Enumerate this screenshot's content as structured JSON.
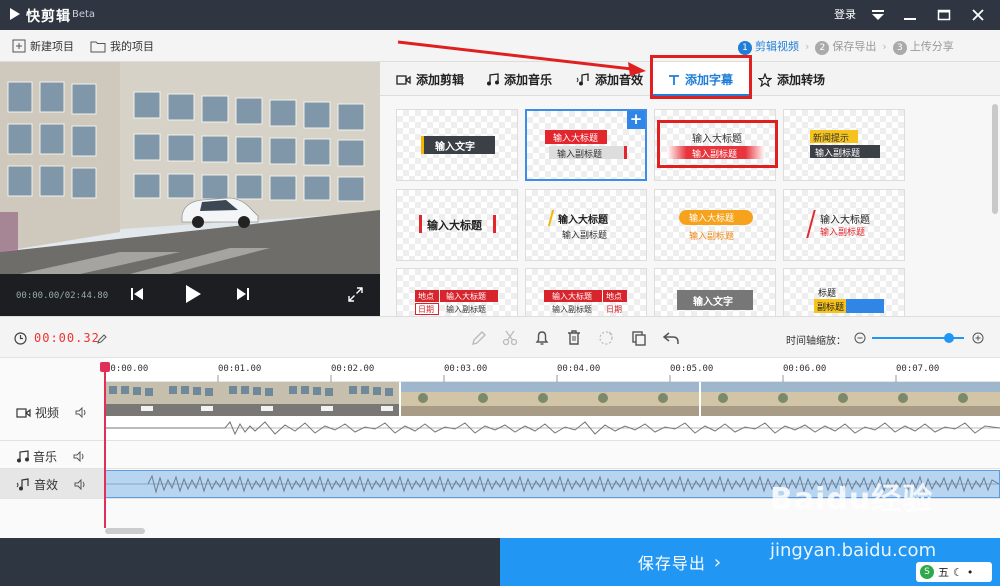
{
  "titlebar": {
    "app_name": "快剪辑",
    "beta": "Beta",
    "login": "登录"
  },
  "toolbar": {
    "new_project": "新建项目",
    "my_projects": "我的项目",
    "steps": [
      {
        "num": "1",
        "label": "剪辑视频"
      },
      {
        "num": "2",
        "label": "保存导出"
      },
      {
        "num": "3",
        "label": "上传分享"
      }
    ]
  },
  "player": {
    "time": "00:00.00/02:44.80"
  },
  "tabs": [
    {
      "label": "添加剪辑",
      "icon": "video-camera-icon"
    },
    {
      "label": "添加音乐",
      "icon": "music-note-icon"
    },
    {
      "label": "添加音效",
      "icon": "sound-effect-icon"
    },
    {
      "label": "添加字幕",
      "icon": "text-t-icon"
    },
    {
      "label": "添加转场",
      "icon": "transition-icon"
    }
  ],
  "subtitle_cards": [
    {
      "lines": [
        "输入文字"
      ]
    },
    {
      "lines": [
        "输入大标题",
        "输入副标题"
      ]
    },
    {
      "lines": [
        "输入大标题",
        "输入副标题"
      ]
    },
    {
      "lines": [
        "新闻提示",
        "输入副标题"
      ]
    },
    {
      "lines": [
        "输入大标题"
      ]
    },
    {
      "lines": [
        "输入大标题",
        "输入副标题"
      ]
    },
    {
      "lines": [
        "输入大标题",
        "输入副标题"
      ]
    },
    {
      "lines": [
        "输入大标题",
        "输入副标题"
      ]
    },
    {
      "lines": [
        "地点",
        "输入大标题",
        "日期",
        "输入副标题"
      ]
    },
    {
      "lines": [
        "输入大标题",
        "地点",
        "输入副标题",
        "日期"
      ]
    },
    {
      "lines": [
        "输入文字"
      ]
    },
    {
      "lines": [
        "标题",
        "副标题"
      ]
    }
  ],
  "edit": {
    "current_time": "00:00.32",
    "zoom_label": "时间轴缩放："
  },
  "ruler": {
    "ticks": [
      "00:00.00",
      "00:01.00",
      "00:02.00",
      "00:03.00",
      "00:04.00",
      "00:05.00",
      "00:06.00",
      "00:07.00"
    ]
  },
  "tracks": {
    "video": "视频",
    "music": "音乐",
    "sfx": "音效"
  },
  "bottom": {
    "export": "保存导出"
  },
  "watermark": {
    "brand": "Baidu经验",
    "url": "jingyan.baidu.com"
  },
  "tray": {
    "label": "五"
  },
  "colors": {
    "accent": "#1e7ed8",
    "highlight_box": "#e02020",
    "titlebar": "#2f3641",
    "export_button": "#2196f3"
  }
}
